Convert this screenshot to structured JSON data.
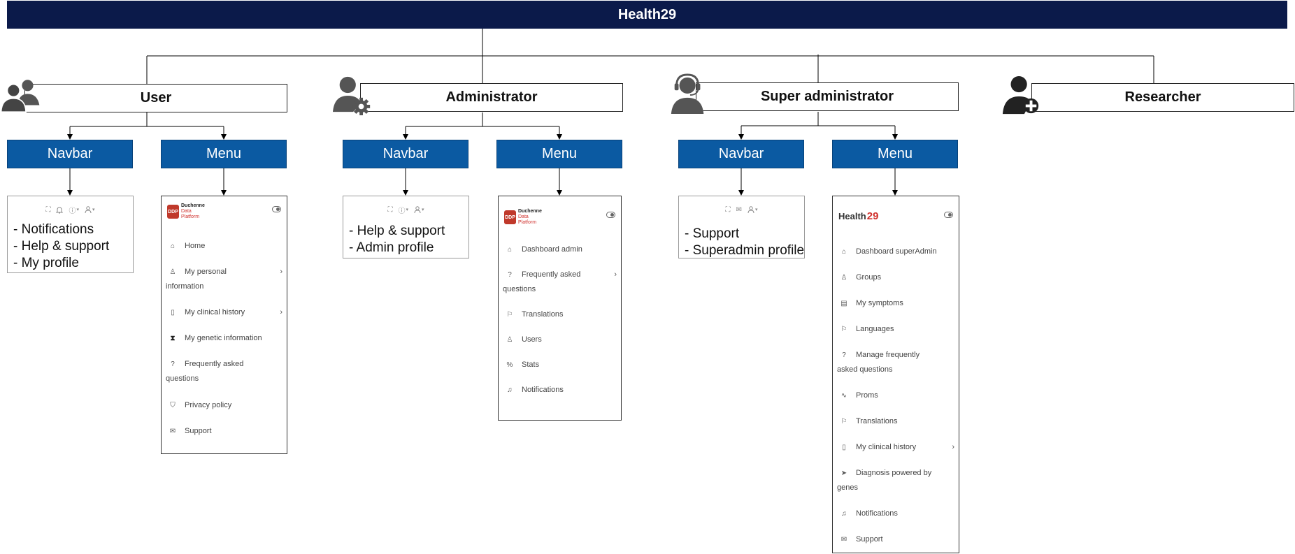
{
  "title": "Health29",
  "roles": [
    {
      "name": "User",
      "icon": "users-group-icon"
    },
    {
      "name": "Administrator",
      "icon": "user-gear-icon"
    },
    {
      "name": "Super administrator",
      "icon": "user-headset-icon"
    },
    {
      "name": "Researcher",
      "icon": "user-plus-icon"
    }
  ],
  "labels": {
    "navbar": "Navbar",
    "menu": "Menu"
  },
  "navbars": [
    {
      "icons": [
        "fullscreen-icon",
        "bell-icon",
        "help-circle-icon",
        "user-icon"
      ],
      "lines": [
        "- Notifications",
        "- Help & support",
        "- My profile"
      ]
    },
    {
      "icons": [
        "fullscreen-icon",
        "help-circle-icon",
        "user-icon"
      ],
      "lines": [
        "- Help & support",
        "- Admin profile"
      ]
    },
    {
      "icons": [
        "fullscreen-icon",
        "mail-icon",
        "user-icon"
      ],
      "lines": [
        "- Support",
        "- Superadmin profile"
      ]
    }
  ],
  "menus": [
    {
      "logo": {
        "badge": "DDP",
        "line1": "Duchenne",
        "line2": "Data",
        "line3": "Platform"
      },
      "items": [
        {
          "label": "Home",
          "icon": "home-icon"
        },
        {
          "label": "My personal",
          "label2": "information",
          "icon": "user-icon",
          "chevron": "›"
        },
        {
          "label": "My clinical history",
          "icon": "clipboard-icon",
          "chevron": "›"
        },
        {
          "label": "My genetic information",
          "icon": "dna-icon"
        },
        {
          "label": "Frequently asked",
          "label2": "questions",
          "icon": "help-circle-icon"
        },
        {
          "label": "Privacy policy",
          "icon": "shield-icon"
        },
        {
          "label": "Support",
          "icon": "mail-icon"
        }
      ]
    },
    {
      "logo": {
        "badge": "DDP",
        "line1": "Duchenne",
        "line2": "Data",
        "line3": "Platform"
      },
      "items": [
        {
          "label": "Dashboard admin",
          "icon": "home-icon"
        },
        {
          "label": "Frequently asked",
          "label2": "questions",
          "icon": "help-circle-icon",
          "chevron": "›"
        },
        {
          "label": "Translations",
          "icon": "flag-icon"
        },
        {
          "label": "Users",
          "icon": "users-icon"
        },
        {
          "label": "Stats",
          "icon": "percent-icon"
        },
        {
          "label": "Notifications",
          "icon": "bell-icon"
        }
      ]
    },
    {
      "logo": {
        "text": "Health",
        "num": "29"
      },
      "items": [
        {
          "label": "Dashboard superAdmin",
          "icon": "home-icon"
        },
        {
          "label": "Groups",
          "icon": "users-icon"
        },
        {
          "label": "My symptoms",
          "icon": "document-icon"
        },
        {
          "label": "Languages",
          "icon": "flag-icon"
        },
        {
          "label": "Manage frequently",
          "label2": "asked questions",
          "icon": "help-circle-icon"
        },
        {
          "label": "Proms",
          "icon": "activity-icon"
        },
        {
          "label": "Translations",
          "icon": "flag-icon"
        },
        {
          "label": "My clinical history",
          "icon": "clipboard-icon",
          "chevron": "›"
        },
        {
          "label": "Diagnosis powered by",
          "label2": "genes",
          "icon": "navigation-icon"
        },
        {
          "label": "Notifications",
          "icon": "bell-icon"
        },
        {
          "label": "Support",
          "icon": "mail-icon"
        }
      ]
    }
  ]
}
